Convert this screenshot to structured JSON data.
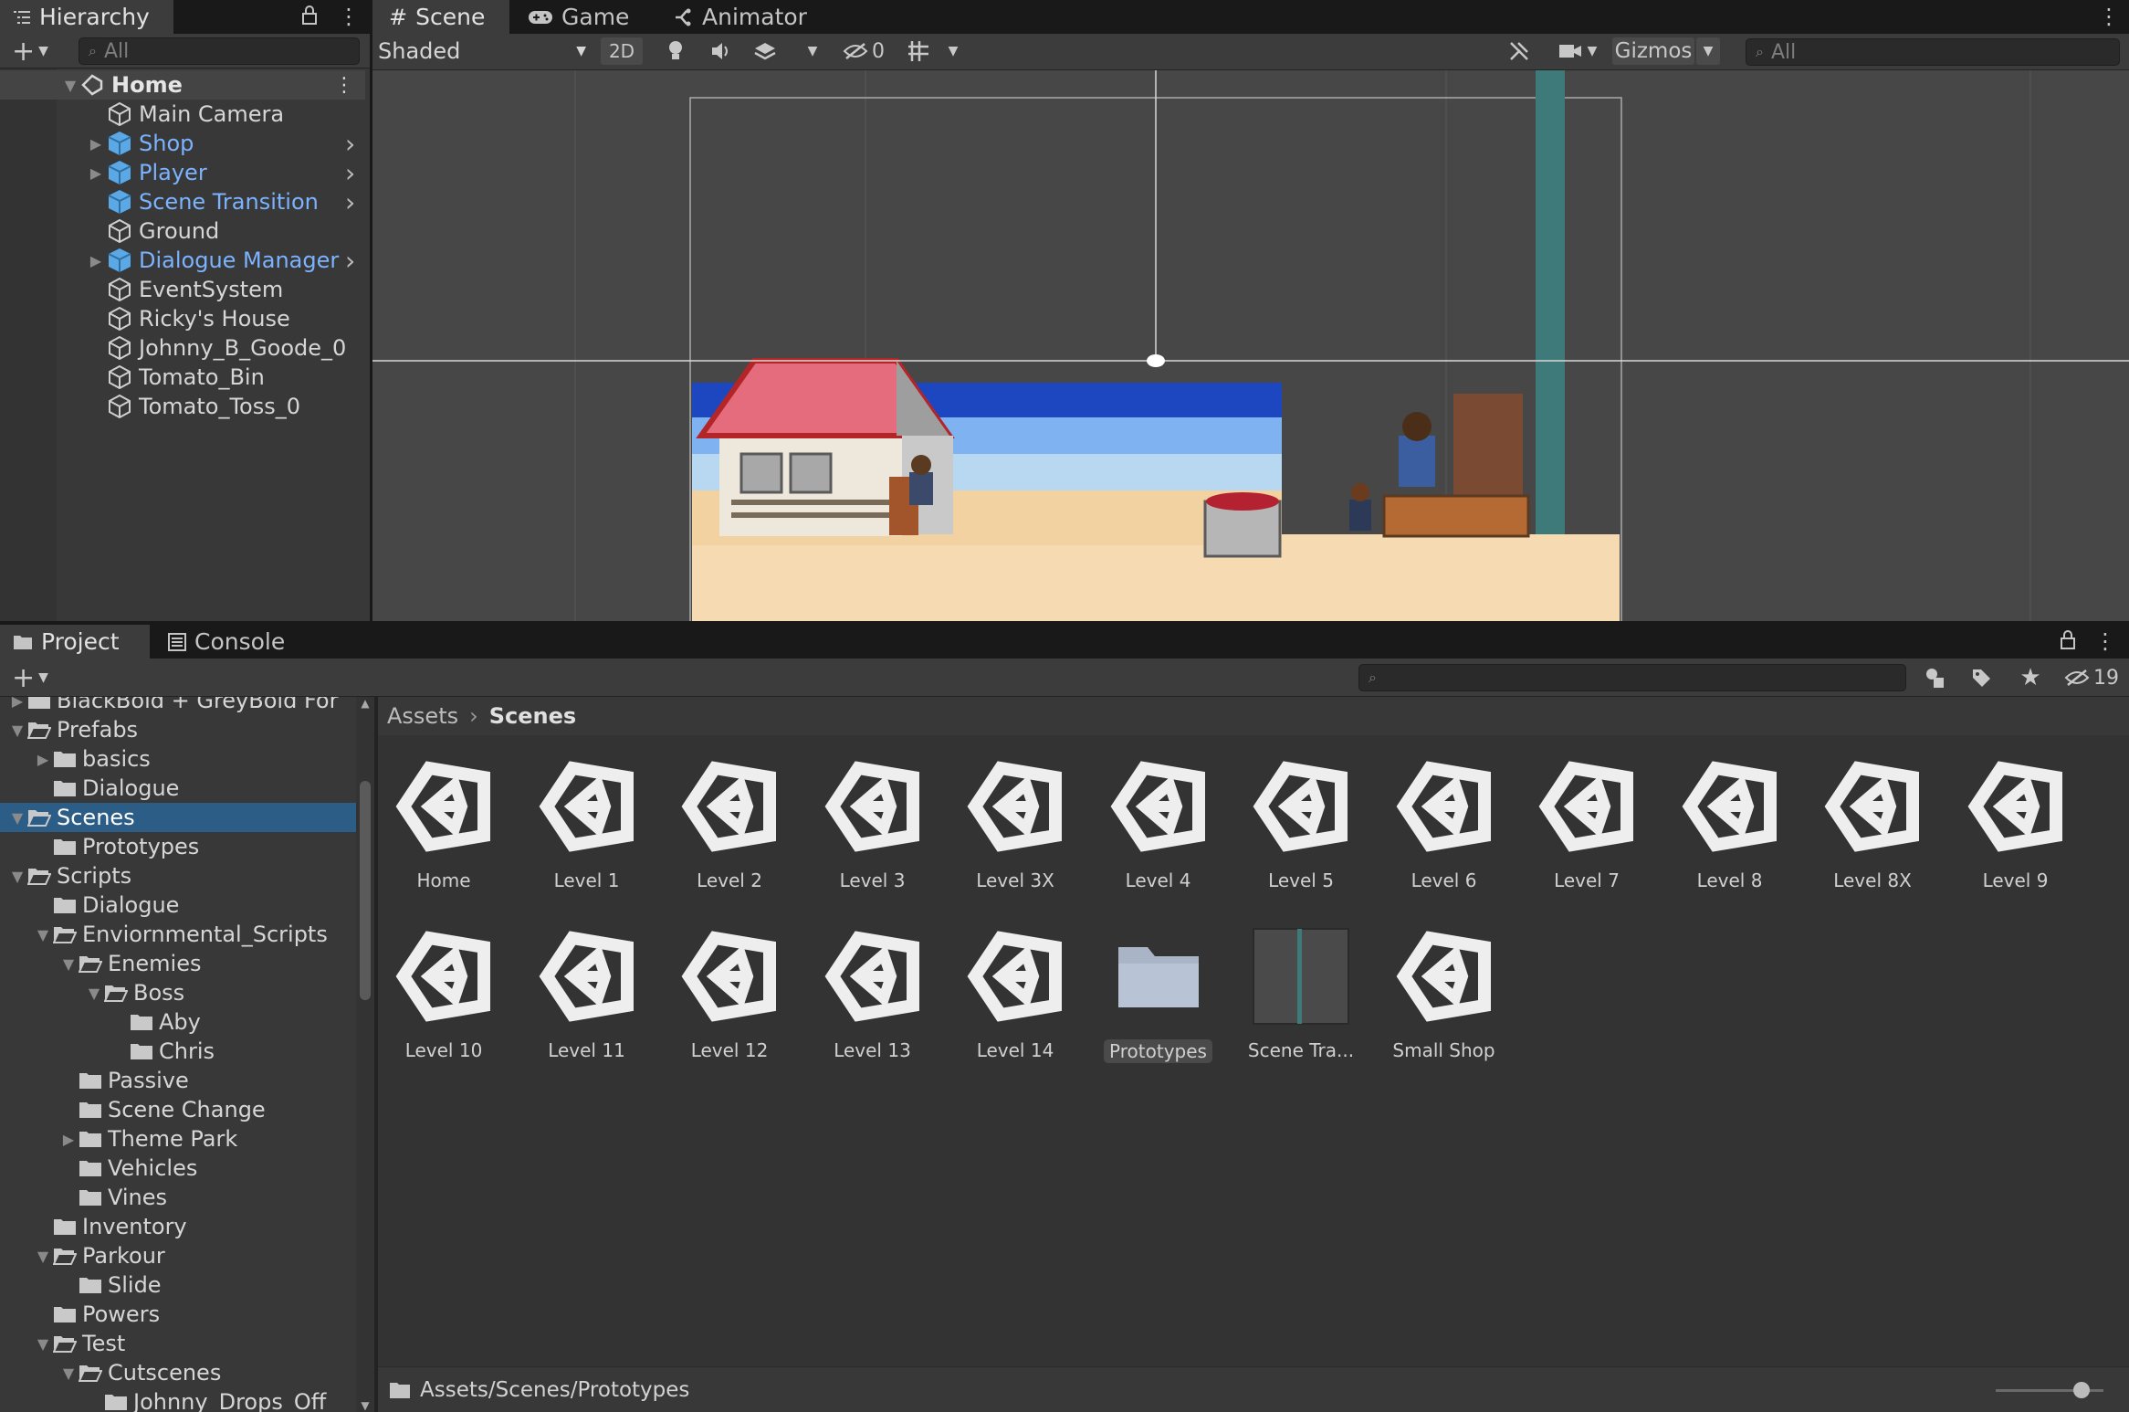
{
  "hierarchy": {
    "tab_label": "Hierarchy",
    "search_placeholder": "All",
    "scene_name": "Home",
    "items": [
      {
        "label": "Main Camera",
        "prefab": false,
        "expandable": false
      },
      {
        "label": "Shop",
        "prefab": true,
        "expandable": true
      },
      {
        "label": "Player",
        "prefab": true,
        "expandable": true
      },
      {
        "label": "Scene Transition",
        "prefab": true,
        "expandable": false
      },
      {
        "label": "Ground",
        "prefab": false,
        "expandable": false
      },
      {
        "label": "Dialogue Manager",
        "prefab": true,
        "expandable": true
      },
      {
        "label": "EventSystem",
        "prefab": false,
        "expandable": false
      },
      {
        "label": "Ricky's House",
        "prefab": false,
        "expandable": false
      },
      {
        "label": "Johnny_B_Goode_0",
        "prefab": false,
        "expandable": false
      },
      {
        "label": "Tomato_Bin",
        "prefab": false,
        "expandable": false
      },
      {
        "label": "Tomato_Toss_0",
        "prefab": false,
        "expandable": false
      }
    ]
  },
  "scene_view": {
    "tabs": [
      "Scene",
      "Game",
      "Animator"
    ],
    "shading_mode": "Shaded",
    "mode_2d": "2D",
    "hidden_count": "0",
    "gizmos_label": "Gizmos",
    "search_placeholder": "All"
  },
  "project": {
    "tabs": [
      "Project",
      "Console"
    ],
    "hidden_count": "19",
    "breadcrumb": [
      "Assets",
      "Scenes"
    ],
    "status_path": "Assets/Scenes/Prototypes",
    "tree": [
      {
        "label": "BlackBold + GreyBold For",
        "depth": 1,
        "arrow": "right",
        "open": false
      },
      {
        "label": "Prefabs",
        "depth": 1,
        "arrow": "down",
        "open": true
      },
      {
        "label": "basics",
        "depth": 2,
        "arrow": "right",
        "open": false
      },
      {
        "label": "Dialogue",
        "depth": 2,
        "arrow": "",
        "open": false
      },
      {
        "label": "Scenes",
        "depth": 1,
        "arrow": "down",
        "open": true,
        "selected": true
      },
      {
        "label": "Prototypes",
        "depth": 2,
        "arrow": "",
        "open": false
      },
      {
        "label": "Scripts",
        "depth": 1,
        "arrow": "down",
        "open": true
      },
      {
        "label": "Dialogue",
        "depth": 2,
        "arrow": "",
        "open": false
      },
      {
        "label": "Enviornmental_Scripts",
        "depth": 2,
        "arrow": "down",
        "open": true
      },
      {
        "label": "Enemies",
        "depth": 3,
        "arrow": "down",
        "open": true
      },
      {
        "label": "Boss",
        "depth": 4,
        "arrow": "down",
        "open": true
      },
      {
        "label": "Aby",
        "depth": 5,
        "arrow": "",
        "open": false
      },
      {
        "label": "Chris",
        "depth": 5,
        "arrow": "",
        "open": false
      },
      {
        "label": "Passive",
        "depth": 3,
        "arrow": "",
        "open": false
      },
      {
        "label": "Scene Change",
        "depth": 3,
        "arrow": "",
        "open": false
      },
      {
        "label": "Theme Park",
        "depth": 3,
        "arrow": "right",
        "open": false
      },
      {
        "label": "Vehicles",
        "depth": 3,
        "arrow": "",
        "open": false
      },
      {
        "label": "Vines",
        "depth": 3,
        "arrow": "",
        "open": false
      },
      {
        "label": "Inventory",
        "depth": 2,
        "arrow": "",
        "open": false
      },
      {
        "label": "Parkour",
        "depth": 2,
        "arrow": "down",
        "open": true
      },
      {
        "label": "Slide",
        "depth": 3,
        "arrow": "",
        "open": false
      },
      {
        "label": "Powers",
        "depth": 2,
        "arrow": "",
        "open": false
      },
      {
        "label": "Test",
        "depth": 2,
        "arrow": "down",
        "open": true
      },
      {
        "label": "Cutscenes",
        "depth": 3,
        "arrow": "down",
        "open": true
      },
      {
        "label": "Johnny_Drops_Off",
        "depth": 4,
        "arrow": "",
        "open": false
      }
    ],
    "assets": [
      {
        "label": "Home",
        "kind": "scene"
      },
      {
        "label": "Level 1",
        "kind": "scene"
      },
      {
        "label": "Level 2",
        "kind": "scene"
      },
      {
        "label": "Level 3",
        "kind": "scene"
      },
      {
        "label": "Level 3X",
        "kind": "scene"
      },
      {
        "label": "Level 4",
        "kind": "scene"
      },
      {
        "label": "Level 5",
        "kind": "scene"
      },
      {
        "label": "Level 6",
        "kind": "scene"
      },
      {
        "label": "Level 7",
        "kind": "scene"
      },
      {
        "label": "Level 8",
        "kind": "scene"
      },
      {
        "label": "Level 8X",
        "kind": "scene"
      },
      {
        "label": "Level 9",
        "kind": "scene"
      },
      {
        "label": "Level 10",
        "kind": "scene"
      },
      {
        "label": "Level 11",
        "kind": "scene"
      },
      {
        "label": "Level 12",
        "kind": "scene"
      },
      {
        "label": "Level 13",
        "kind": "scene"
      },
      {
        "label": "Level 14",
        "kind": "scene"
      },
      {
        "label": "Prototypes",
        "kind": "folder",
        "selected": true
      },
      {
        "label": "Scene Tra...",
        "kind": "prefab-preview"
      },
      {
        "label": "Small Shop",
        "kind": "scene"
      }
    ],
    "zoom_level": 0.8
  },
  "colors": {
    "accent_selected": "#2c5d87",
    "prefab_text": "#7cb3ff",
    "panel_bg": "#383838",
    "scene_bg": "#474747"
  }
}
